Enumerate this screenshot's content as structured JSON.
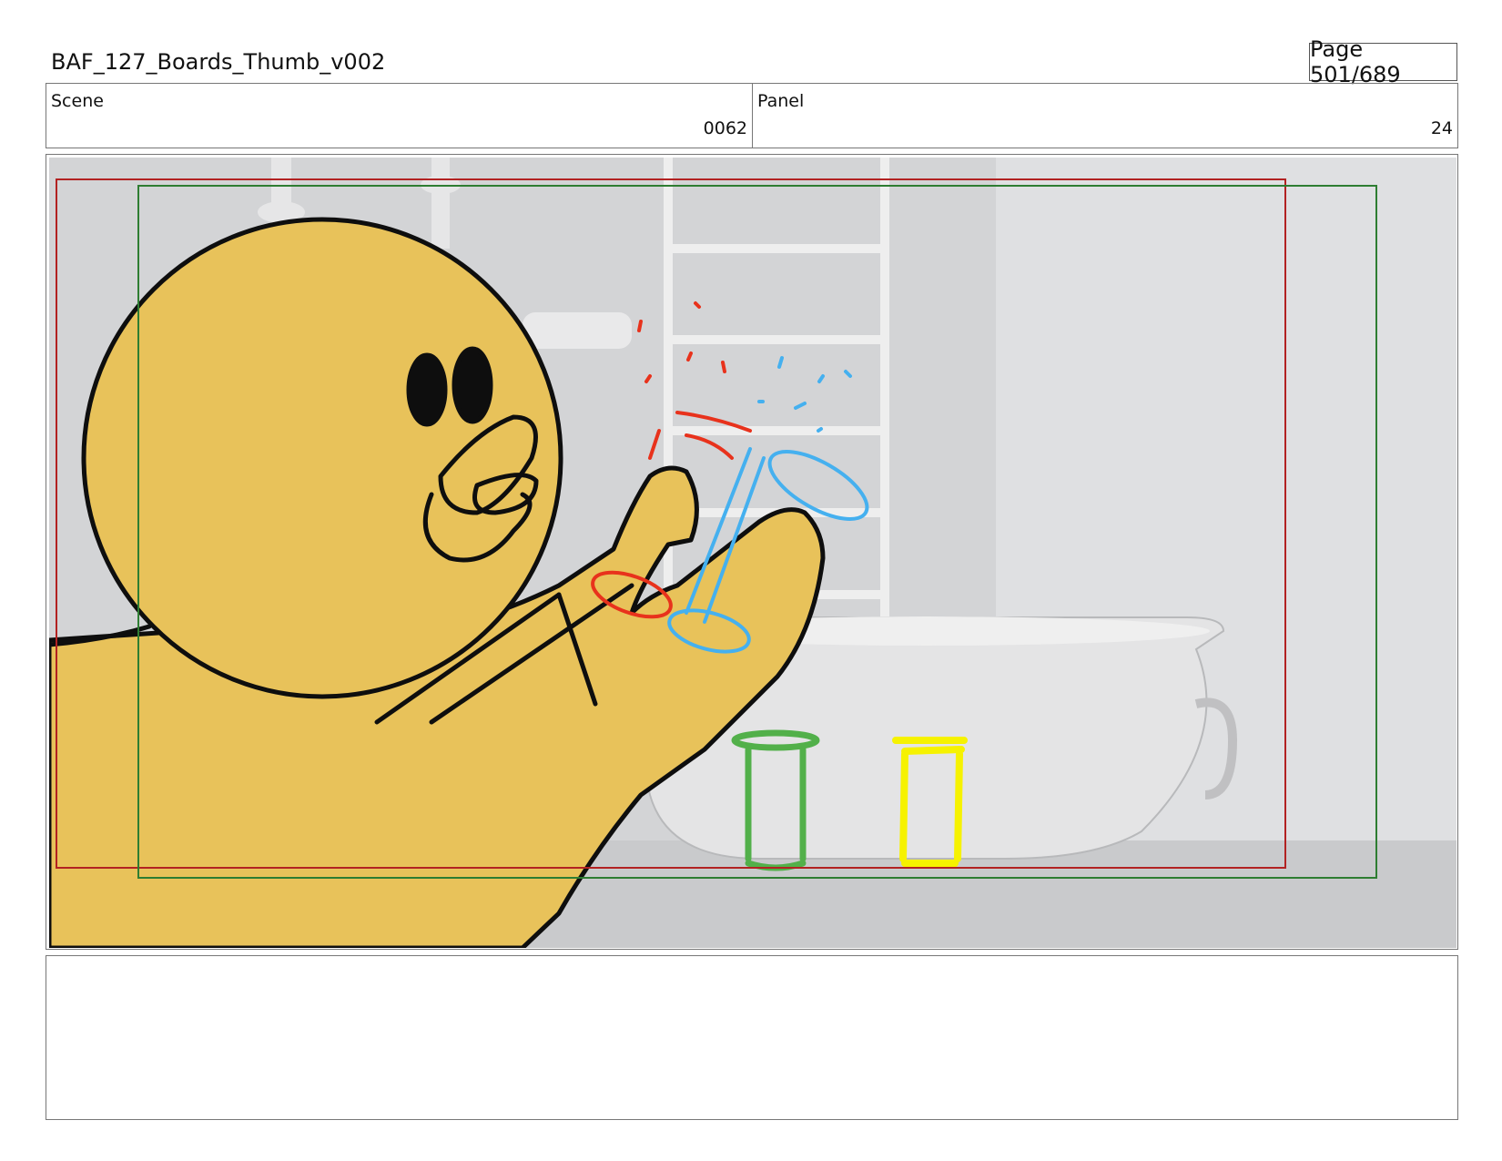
{
  "header": {
    "title": "BAF_127_Boards_Thumb_v002",
    "page": "Page 501/689"
  },
  "info": {
    "scene_label": "Scene",
    "scene_value": "0062",
    "panel_label": "Panel",
    "panel_value": "24"
  },
  "colors": {
    "background_gray": "#d2d3d5",
    "character_yellow": "#e8c25a",
    "red_safe_frame": "#b22222",
    "green_safe_frame": "#2e7d32",
    "sketch_red": "#e8321c",
    "sketch_blue": "#45b0ef",
    "sketch_green": "#52b04a",
    "sketch_yellow": "#f6f200"
  },
  "notes": {
    "text": ""
  }
}
